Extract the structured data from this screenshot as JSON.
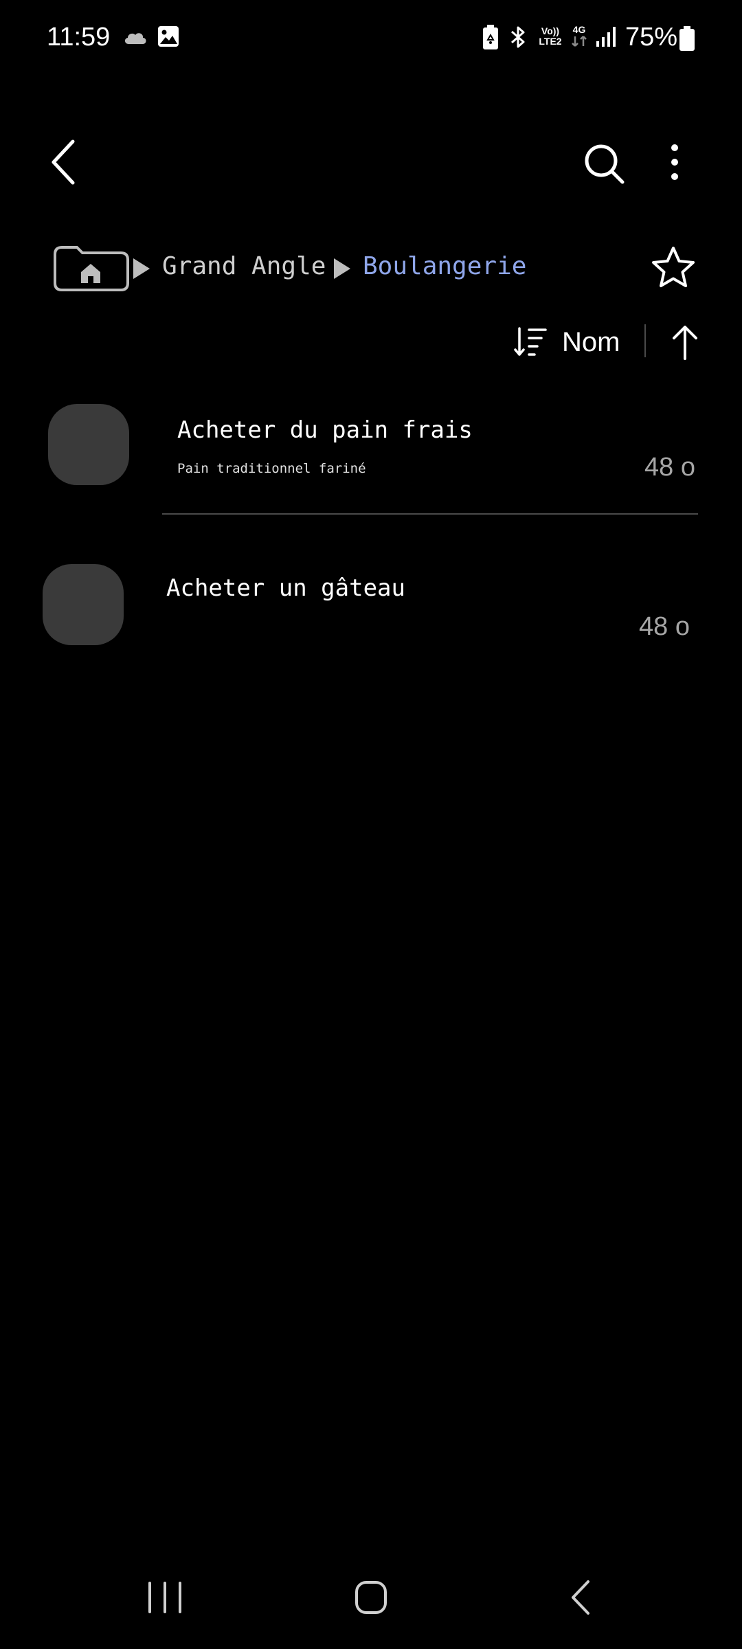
{
  "status_bar": {
    "time": "11:59",
    "volte_top": "Vo))",
    "volte_bottom": "LTE2",
    "network": "4G",
    "battery_percent": "75%"
  },
  "breadcrumb": {
    "parent": "Grand Angle",
    "current": "Boulangerie"
  },
  "sort": {
    "label": "Nom"
  },
  "items": [
    {
      "title": "Acheter du pain frais",
      "subtitle": "Pain traditionnel fariné",
      "size": "48 o"
    },
    {
      "title": "Acheter un gâteau",
      "size": "48 o"
    }
  ],
  "colors": {
    "background": "#000000",
    "breadcrumb_current": "#8fa6ea",
    "thumbnail": "#3a3a3a",
    "size_text": "#a6a6a6"
  }
}
